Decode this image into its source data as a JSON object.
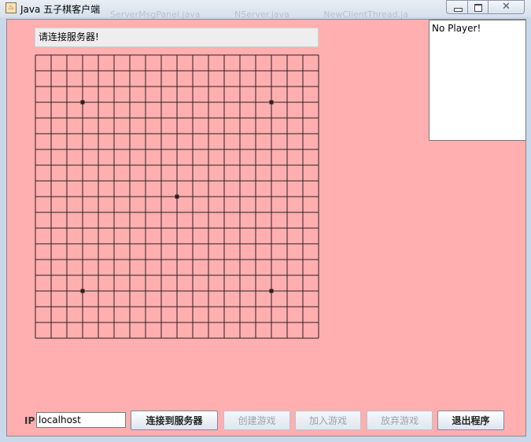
{
  "window": {
    "title": "Java 五子棋客户端",
    "background_tabs": [
      "ServerMsgPanel.java",
      "NServer.java",
      "NewClientThread.ja"
    ]
  },
  "status": {
    "text": "请连接服务器!"
  },
  "players": {
    "text": "No Player!"
  },
  "board": {
    "lines": 19,
    "star_points": [
      [
        3,
        3
      ],
      [
        15,
        3
      ],
      [
        9,
        9
      ],
      [
        3,
        15
      ],
      [
        15,
        15
      ]
    ]
  },
  "ip": {
    "label": "IP",
    "value": "localhost"
  },
  "buttons": {
    "connect": "连接到服务器",
    "create": "创建游戏",
    "join": "加入游戏",
    "abandon": "放弃游戏",
    "exit": "退出程序"
  },
  "colors": {
    "panel_bg": "#ffafaf",
    "grid_line": "#2a1f1f",
    "disabled_text": "#9aa3ad"
  }
}
